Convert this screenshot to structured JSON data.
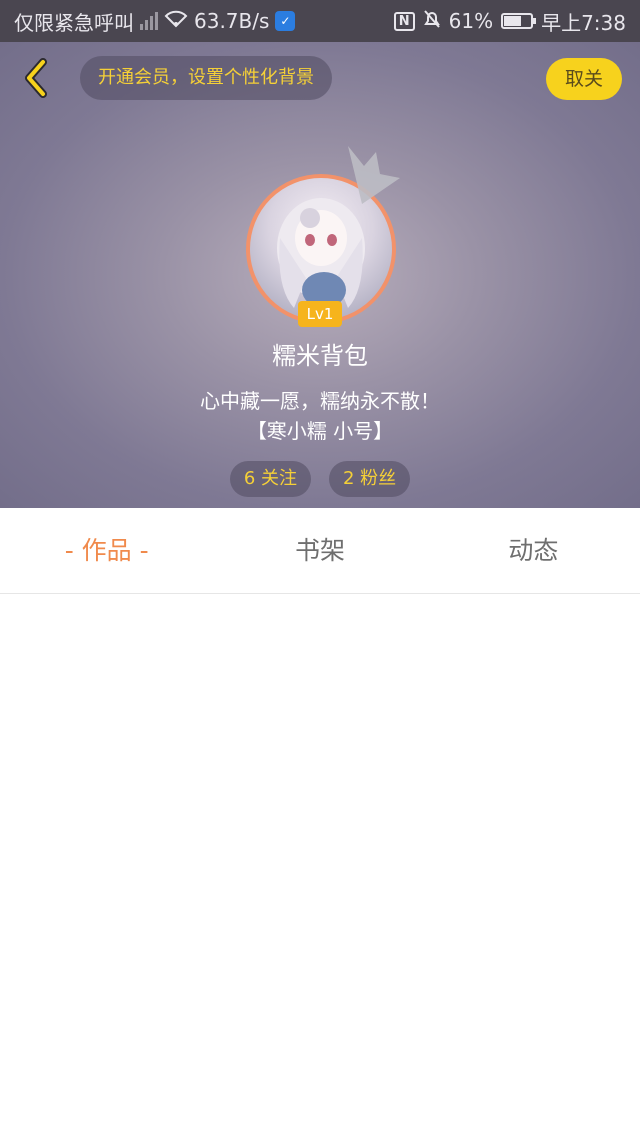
{
  "status_bar": {
    "carrier_text": "仅限紧急呼叫",
    "speed": "63.7B/s",
    "battery_percent": "61%",
    "battery_level": 0.61,
    "time": "早上7:38"
  },
  "header": {
    "vip_banner": "开通会员，设置个性化背景",
    "unfollow_label": "取关"
  },
  "profile": {
    "level": "Lv1",
    "username": "糯米背包",
    "bio_line1": "心中藏一愿，糯纳永不散！",
    "bio_line2": "【寒小糯 小号】",
    "following": "6 关注",
    "followers": "2 粉丝"
  },
  "tabs": [
    {
      "label": "- 作品 -",
      "active": true
    },
    {
      "label": "书架",
      "active": false
    },
    {
      "label": "动态",
      "active": false
    }
  ],
  "colors": {
    "accent": "#f08a4c",
    "yellow": "#f7d21d",
    "banner_text": "#f5d037"
  }
}
